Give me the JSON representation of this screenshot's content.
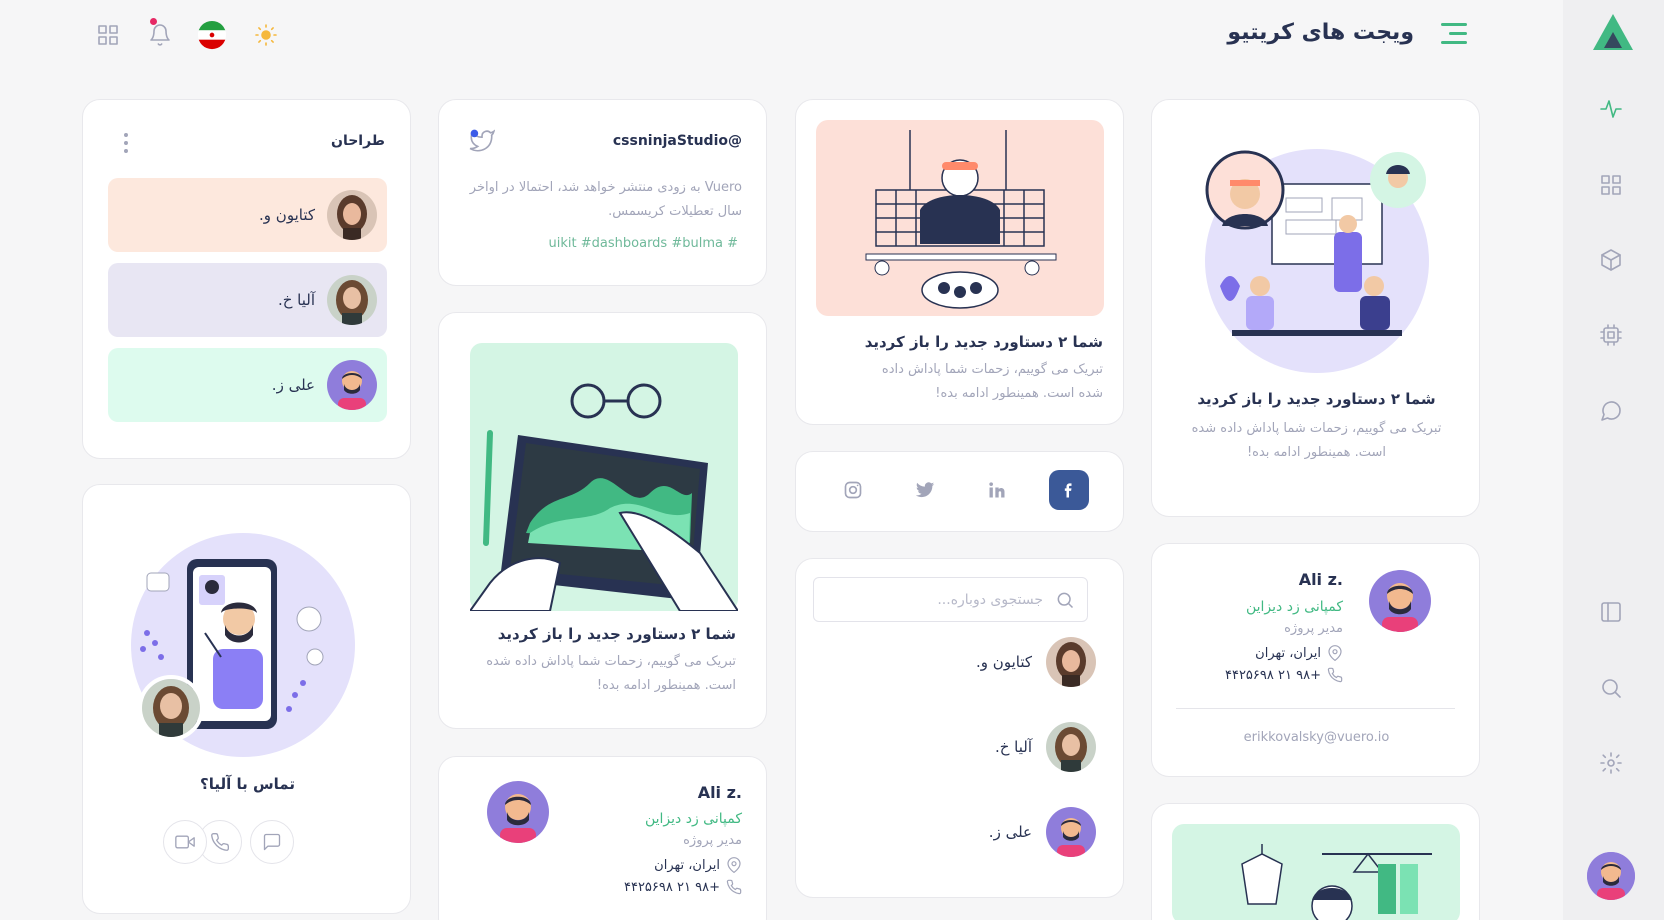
{
  "header": {
    "title": "ویجت های کریتیو"
  },
  "designers_card": {
    "title": "طراحان",
    "people": [
      {
        "name": "کتایون و.",
        "bg": "#fde8dd"
      },
      {
        "name": "آلیا خ.",
        "bg": "#e8e6f3"
      },
      {
        "name": "علی ز.",
        "bg": "#ddfbee"
      }
    ]
  },
  "tweet_card": {
    "handle": "cssninjaStudio@",
    "text_line1": "Vuero به زودی منتشر خواهد شد، احتمالا در اواخر",
    "text_line2": "سال تعطیلات کریسمس.",
    "tags": "uikit #dashboards #bulma #"
  },
  "achievement_cards": [
    {
      "title": "شما ۲ دستاورد جدید را باز کردید",
      "text_line1": "تبریک می گوییم، زحمات شما پاداش داده",
      "text_line2": "شده است. همینطور ادامه بده!"
    },
    {
      "title": "شما ۲ دستاورد جدید را باز کردید",
      "text_line1": "تبریک می گوییم، زحمات شما پاداش داده شده",
      "text_line2": "است. همینطور ادامه بده!"
    },
    {
      "title": "شما ۲ دستاورد جدید را باز کردید",
      "text_line1": "تبریک می گوییم، زحمات شما پاداش داده شده",
      "text_line2": "است. همینطور ادامه بده!"
    }
  ],
  "call_card": {
    "title": "تماس با آلیا؟"
  },
  "profile_card": {
    "name": "Ali z.",
    "company": "کمپانی زد دیزاین",
    "role": "مدیر پروژه",
    "location": "ایران، تهران",
    "phone": "+۹۸ ۲۱ ۴۴۲۵۶۹۸",
    "email": "erikkovalsky@vuero.io"
  },
  "profile_card_2": {
    "name": "Ali z.",
    "company": "کمپانی زد دیزاین",
    "role": "مدیر پروژه",
    "location": "ایران، تهران",
    "phone": "+۹۸ ۲۱ ۴۴۲۵۶۹۸"
  },
  "search_card": {
    "placeholder": "جستجوی دوباره...",
    "people": [
      {
        "name": "کتایون و."
      },
      {
        "name": "آلیا خ."
      },
      {
        "name": "علی ز."
      }
    ]
  },
  "social": {
    "icons": [
      "facebook-icon",
      "linkedin-icon",
      "twitter-icon",
      "instagram-icon"
    ],
    "active_color": "#3b5998"
  },
  "colors": {
    "accent": "#41b983",
    "primary_text": "#283252",
    "muted": "#a2a5b9"
  }
}
